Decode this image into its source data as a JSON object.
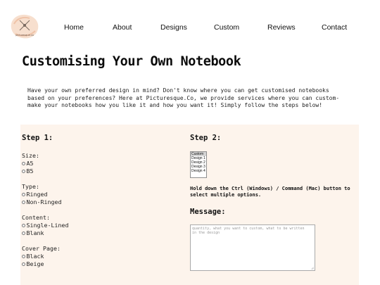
{
  "header": {
    "logo_text": "picturesque.co",
    "nav": [
      "Home",
      "About",
      "Designs",
      "Custom",
      "Reviews",
      "Contact"
    ]
  },
  "page_title": "Customising Your Own Notebook",
  "intro_lines": [
    "Have your own preferred design in mind? Don't know where you can get customised notebooks",
    "based on your preferences? Here at Picturesque.Co, we provide services where you can custom-",
    "make your notebooks how you like it and how you want it! Simply follow the steps below!"
  ],
  "step1": {
    "title": "Step 1:",
    "groups": [
      {
        "label": "Size:",
        "options": [
          "A5",
          "B5"
        ]
      },
      {
        "label": "Type:",
        "options": [
          "Ringed",
          "Non-Ringed"
        ]
      },
      {
        "label": "Content:",
        "options": [
          "Single-Lined",
          "Blank"
        ]
      },
      {
        "label": "Cover Page:",
        "options": [
          "Black",
          "Beige"
        ]
      }
    ]
  },
  "step2": {
    "title": "Step 2:",
    "design_options": [
      "Custom",
      "Design 1",
      "Design 2",
      "Design 3",
      "Design 4"
    ],
    "selected": "Custom",
    "hint_lines": [
      "Hold down the Ctrl (Windows) / Command (Mac) button to",
      "select multiple options."
    ]
  },
  "message": {
    "label": "Message:",
    "placeholder_lines": [
      "quantity, what you want to custom, what to be written",
      "in the design"
    ]
  },
  "colors": {
    "panel_bg": "#fdf4ec",
    "logo_splash": "#f6d9c6"
  }
}
